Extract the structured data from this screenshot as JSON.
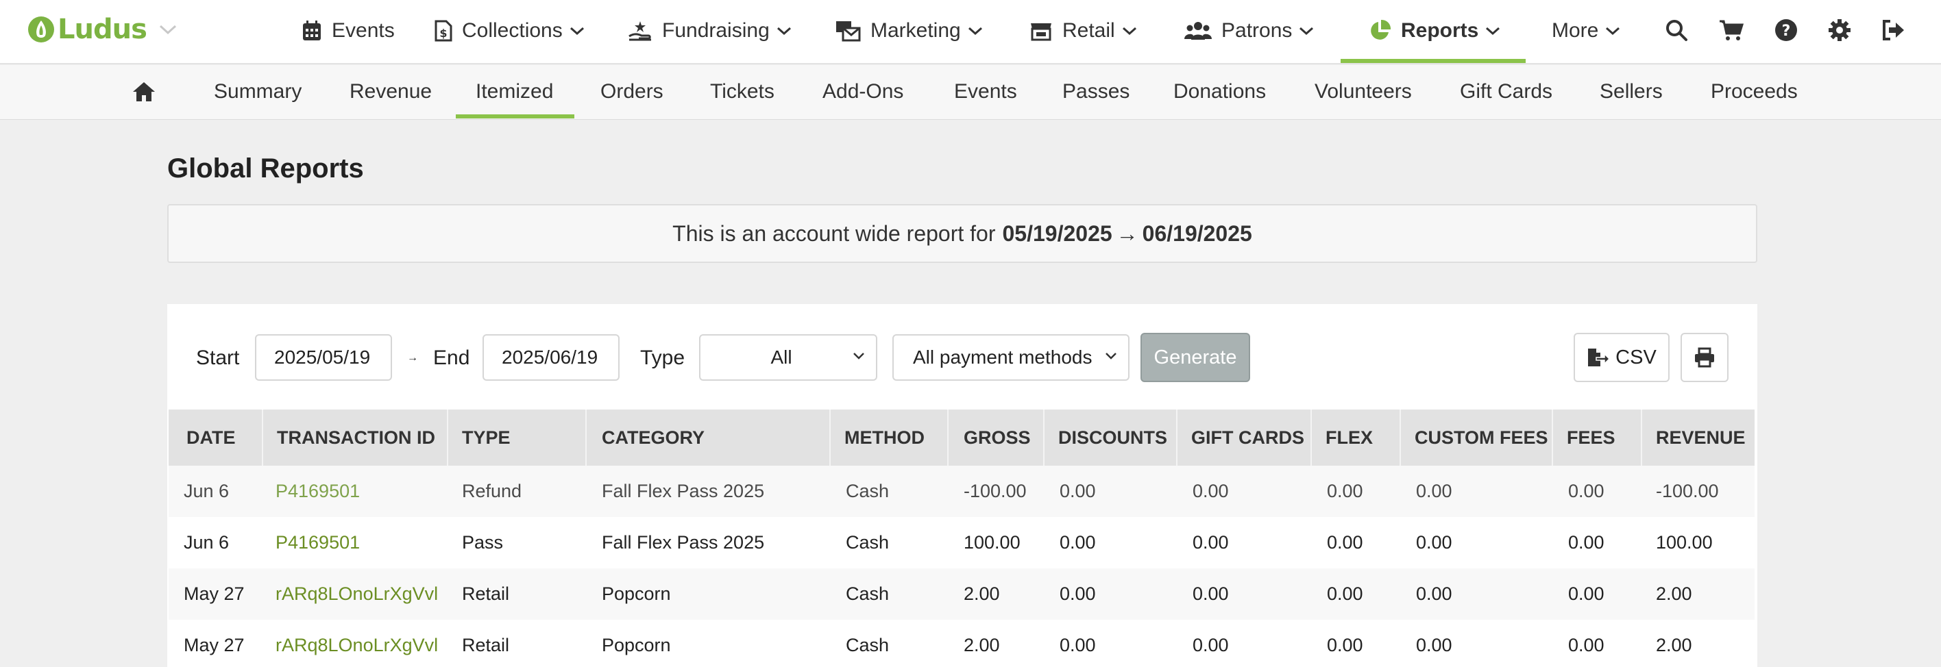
{
  "brand": {
    "name": "Ludus",
    "color": "#7cb342"
  },
  "topnav": {
    "items": [
      {
        "key": "events",
        "label": "Events",
        "icon": "calendar-icon"
      },
      {
        "key": "collections",
        "label": "Collections",
        "icon": "money-file-icon"
      },
      {
        "key": "fundraising",
        "label": "Fundraising",
        "icon": "hand-donation-icon"
      },
      {
        "key": "marketing",
        "label": "Marketing",
        "icon": "mail-bulk-icon"
      },
      {
        "key": "retail",
        "label": "Retail",
        "icon": "store-icon"
      },
      {
        "key": "patrons",
        "label": "Patrons",
        "icon": "users-icon"
      },
      {
        "key": "reports",
        "label": "Reports",
        "icon": "pie-chart-icon",
        "active": true
      },
      {
        "key": "more",
        "label": "More"
      }
    ],
    "utility_icons": [
      "search-icon",
      "cart-icon",
      "help-icon",
      "gear-icon",
      "logout-icon"
    ]
  },
  "subnav": {
    "home_icon": "home-icon",
    "items": [
      "Summary",
      "Revenue",
      "Itemized",
      "Orders",
      "Tickets",
      "Add-Ons",
      "Events",
      "Passes",
      "Donations",
      "Volunteers",
      "Gift Cards",
      "Sellers",
      "Proceeds"
    ],
    "active": "Itemized"
  },
  "page": {
    "title": "Global Reports",
    "banner_prefix": "This is an account wide report for",
    "banner_start": "05/19/2025",
    "banner_arrow": "→",
    "banner_end": "06/19/2025"
  },
  "filters": {
    "start_label": "Start",
    "start_value": "2025/05/19",
    "range_arrow": "→",
    "end_label": "End",
    "end_value": "2025/06/19",
    "type_label": "Type",
    "type_value": "All",
    "payment_value": "All payment methods",
    "generate_label": "Generate",
    "csv_label": "CSV"
  },
  "table": {
    "columns": [
      "DATE",
      "TRANSACTION ID",
      "TYPE",
      "CATEGORY",
      "METHOD",
      "GROSS",
      "DISCOUNTS",
      "GIFT CARDS",
      "FLEX",
      "CUSTOM FEES",
      "FEES",
      "REVENUE"
    ],
    "rows": [
      [
        "Jun 6",
        "P4169501",
        "Refund",
        "Fall Flex Pass 2025",
        "Cash",
        "-100.00",
        "0.00",
        "0.00",
        "0.00",
        "0.00",
        "0.00",
        "-100.00"
      ],
      [
        "Jun 6",
        "P4169501",
        "Pass",
        "Fall Flex Pass 2025",
        "Cash",
        "100.00",
        "0.00",
        "0.00",
        "0.00",
        "0.00",
        "0.00",
        "100.00"
      ],
      [
        "May 27",
        "rARq8LOnoLrXgVvl",
        "Retail",
        "Popcorn",
        "Cash",
        "2.00",
        "0.00",
        "0.00",
        "0.00",
        "0.00",
        "0.00",
        "2.00"
      ],
      [
        "May 27",
        "rARq8LOnoLrXgVvl",
        "Retail",
        "Popcorn",
        "Cash",
        "2.00",
        "0.00",
        "0.00",
        "0.00",
        "0.00",
        "0.00",
        "2.00"
      ]
    ]
  }
}
